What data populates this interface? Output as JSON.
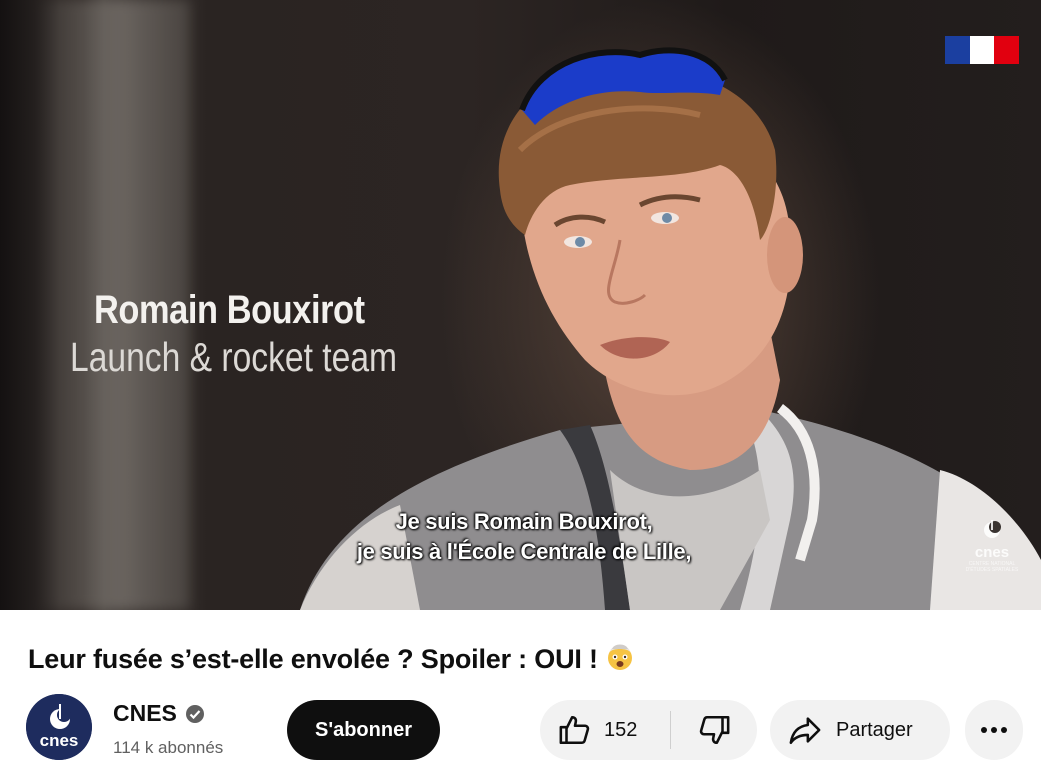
{
  "video": {
    "lower_third_name": "Romain Bouxirot",
    "lower_third_role": "Launch & rocket team",
    "subtitle_line1": "Je suis Romain Bouxirot,",
    "subtitle_line2": "je suis à l'École Centrale de Lille,",
    "watermark_text": "cnes",
    "watermark_small": "CENTRE NATIONAL D'ÉTUDES SPATIALES",
    "flag_colors": [
      "#1b3fa0",
      "#ffffff",
      "#e1000f"
    ]
  },
  "title": "Leur fusée s’est-elle envolée ? Spoiler : OUI !",
  "title_emoji": "🤯",
  "channel": {
    "name": "CNES",
    "subscribers": "114 k abonnés",
    "avatar_text": "cnes",
    "verified_icon": "verified-check-icon"
  },
  "actions": {
    "subscribe_label": "S'abonner",
    "like_count": "152",
    "share_label": "Partager",
    "more_icon": "more-horizontal-icon"
  }
}
